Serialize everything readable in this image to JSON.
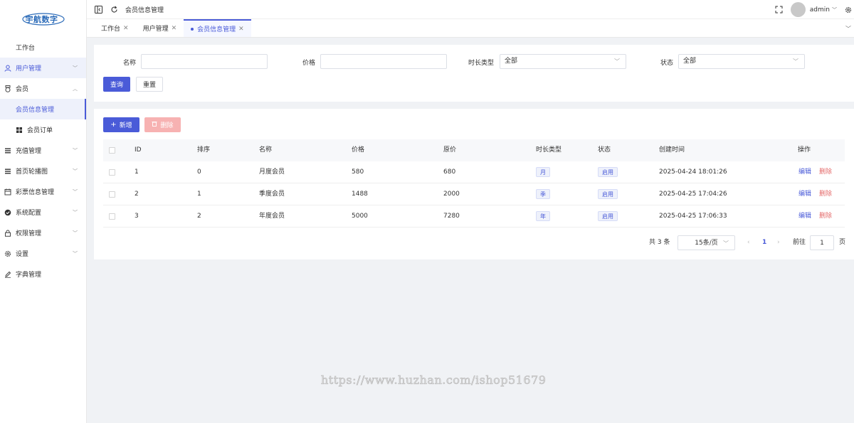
{
  "logo": {
    "text": "宇航数字"
  },
  "sidebar": {
    "items": [
      {
        "label": "工作台",
        "icon": "none",
        "state": "plain"
      },
      {
        "label": "用户管理",
        "icon": "user-icon",
        "state": "highlight",
        "arrow": "chevron-down-icon"
      },
      {
        "label": "会员",
        "icon": "medal-icon",
        "state": "open",
        "arrow": "chevron-up-icon"
      },
      {
        "label": "会员信息管理",
        "icon": "none",
        "state": "active"
      },
      {
        "label": "会员订单",
        "icon": "grid-icon",
        "state": "sub"
      },
      {
        "label": "充值管理",
        "icon": "list-icon",
        "state": "normal",
        "arrow": "chevron-down-icon"
      },
      {
        "label": "首页轮播图",
        "icon": "list-icon",
        "state": "normal",
        "arrow": "chevron-down-icon"
      },
      {
        "label": "彩票信息管理",
        "icon": "calendar-icon",
        "state": "normal",
        "arrow": "chevron-down-icon"
      },
      {
        "label": "系统配置",
        "icon": "check-circle-icon",
        "state": "normal",
        "arrow": "chevron-down-icon"
      },
      {
        "label": "权限管理",
        "icon": "lock-icon",
        "state": "normal",
        "arrow": "chevron-down-icon"
      },
      {
        "label": "设置",
        "icon": "gear-icon",
        "state": "normal",
        "arrow": "chevron-down-icon"
      },
      {
        "label": "字典管理",
        "icon": "pen-icon",
        "state": "normal"
      }
    ]
  },
  "topbar": {
    "breadcrumb": "会员信息管理",
    "user": "admin"
  },
  "tabs": [
    {
      "label": "工作台",
      "active": false
    },
    {
      "label": "用户管理",
      "active": false
    },
    {
      "label": "会员信息管理",
      "active": true
    }
  ],
  "filter": {
    "name_label": "名称",
    "name_value": "",
    "price_label": "价格",
    "price_value": "",
    "duration_label": "时长类型",
    "duration_value": "全部",
    "status_label": "状态",
    "status_value": "全部",
    "query_label": "查询",
    "reset_label": "重置"
  },
  "toolbar": {
    "add_label": "新增",
    "delete_label": "删除"
  },
  "table": {
    "columns": [
      "ID",
      "排序",
      "名称",
      "价格",
      "原价",
      "时长类型",
      "状态",
      "创建时间",
      "操作"
    ],
    "rows": [
      {
        "id": "1",
        "sort": "0",
        "name": "月度会员",
        "price": "580",
        "orig": "680",
        "duration": "月",
        "status": "启用",
        "created": "2025-04-24 18:01:26"
      },
      {
        "id": "2",
        "sort": "1",
        "name": "季度会员",
        "price": "1488",
        "orig": "2000",
        "duration": "季",
        "status": "启用",
        "created": "2025-04-25 17:04:26"
      },
      {
        "id": "3",
        "sort": "2",
        "name": "年度会员",
        "price": "5000",
        "orig": "7280",
        "duration": "年",
        "status": "启用",
        "created": "2025-04-25 17:06:33"
      }
    ],
    "edit_label": "编辑",
    "delete_label": "删除"
  },
  "pager": {
    "total": "共 3 条",
    "page_size": "15条/页",
    "current": "1",
    "goto_label": "前往",
    "goto_value": "1",
    "page_suffix": "页"
  },
  "watermark": "https://www.huzhan.com/ishop51679",
  "colors": {
    "primary": "#4a5bd8",
    "danger": "#e46b6b",
    "danger_light": "#f7b2b2"
  }
}
